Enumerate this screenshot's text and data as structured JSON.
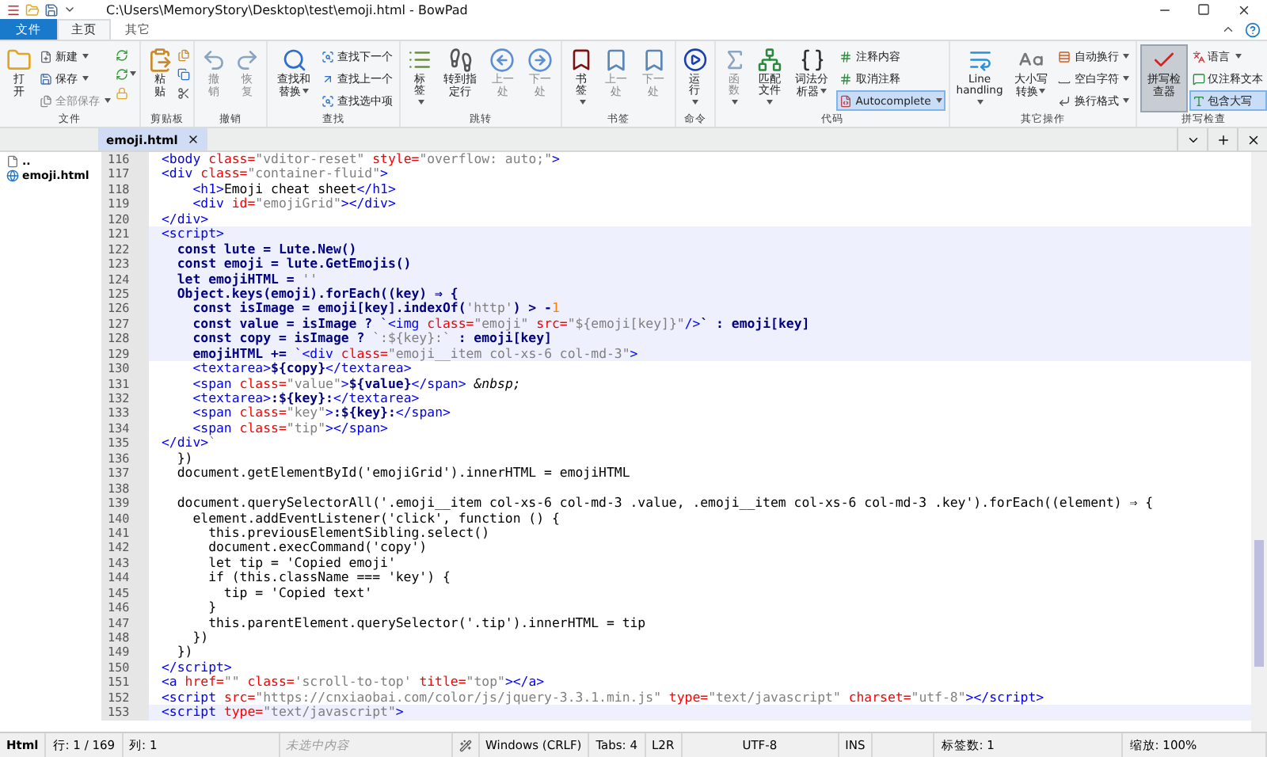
{
  "window": {
    "title": "C:\\Users\\MemoryStory\\Desktop\\test\\emoji.html - BowPad"
  },
  "file_menu": {
    "label": "文件"
  },
  "ribbon_tabs": [
    {
      "label": "主页",
      "selected": true
    },
    {
      "label": "其它",
      "selected": false
    }
  ],
  "ribbon_groups": [
    {
      "label": "文件",
      "large": [
        {
          "label": "打开",
          "dropdown": false,
          "disabled": false,
          "pressed": false
        }
      ],
      "small": [
        {
          "label": "新建",
          "dropdown": true,
          "disabled": false,
          "pressed": false
        },
        {
          "label": "保存",
          "dropdown": true,
          "disabled": false,
          "pressed": false
        },
        {
          "label": "全部保存",
          "dropdown": true,
          "disabled": true,
          "pressed": false
        }
      ],
      "tools": [
        {
          "dropdown": false
        },
        {
          "dropdown": true
        },
        {
          "dropdown": false
        }
      ]
    },
    {
      "label": "剪贴板",
      "large": [
        {
          "label": "粘贴",
          "dropdown": false,
          "disabled": false,
          "pressed": false
        }
      ],
      "tools": [
        {
          "dropdown": false
        },
        {
          "dropdown": false
        },
        {
          "dropdown": false
        }
      ]
    },
    {
      "label": "撤销",
      "large": [
        {
          "label": "撤销",
          "dropdown": false,
          "disabled": true,
          "pressed": false
        },
        {
          "label": "恢复",
          "dropdown": false,
          "disabled": true,
          "pressed": false
        }
      ]
    },
    {
      "label": "查找",
      "large": [
        {
          "label": "查找和替换",
          "dropdown": true,
          "disabled": false,
          "pressed": false
        }
      ],
      "small": [
        {
          "label": "查找下一个",
          "dropdown": false,
          "disabled": false,
          "pressed": false
        },
        {
          "label": "查找上一个",
          "dropdown": false,
          "disabled": false,
          "pressed": false
        },
        {
          "label": "查找选中项",
          "dropdown": false,
          "disabled": false,
          "pressed": false
        }
      ]
    },
    {
      "label": "跳转",
      "large": [
        {
          "label": "标签",
          "dropdown": true,
          "disabled": false,
          "pressed": false
        },
        {
          "label": "转到指定行",
          "dropdown": false,
          "disabled": false,
          "pressed": false
        },
        {
          "label": "上一处",
          "dropdown": false,
          "disabled": true,
          "pressed": false
        },
        {
          "label": "下一处",
          "dropdown": false,
          "disabled": true,
          "pressed": false
        }
      ]
    },
    {
      "label": "书签",
      "large": [
        {
          "label": "书签",
          "dropdown": true,
          "disabled": false,
          "pressed": false
        },
        {
          "label": "上一处",
          "dropdown": false,
          "disabled": true,
          "pressed": false
        },
        {
          "label": "下一处",
          "dropdown": false,
          "disabled": true,
          "pressed": false
        }
      ]
    },
    {
      "label": "命令",
      "large": [
        {
          "label": "运行",
          "dropdown": true,
          "disabled": false,
          "pressed": false
        }
      ]
    },
    {
      "label": "代码",
      "large": [
        {
          "label": "函数",
          "dropdown": true,
          "disabled": true,
          "pressed": false
        },
        {
          "label": "匹配文件",
          "dropdown": true,
          "disabled": false,
          "pressed": false
        },
        {
          "label": "词法分析器",
          "dropdown": true,
          "disabled": false,
          "pressed": false
        }
      ],
      "small": [
        {
          "label": "注释内容",
          "dropdown": false,
          "disabled": false,
          "pressed": false
        },
        {
          "label": "取消注释",
          "dropdown": false,
          "disabled": false,
          "pressed": false
        },
        {
          "label": "Autocomplete",
          "dropdown": true,
          "disabled": false,
          "pressed": true
        }
      ]
    },
    {
      "label": "其它操作",
      "large": [
        {
          "label": "Line handling",
          "dropdown": true,
          "disabled": false,
          "pressed": false
        },
        {
          "label": "大小写转换",
          "dropdown": true,
          "disabled": false,
          "pressed": false
        }
      ],
      "small": [
        {
          "label": "自动换行",
          "dropdown": true,
          "disabled": false,
          "pressed": false
        },
        {
          "label": "空白字符",
          "dropdown": true,
          "disabled": false,
          "pressed": false
        },
        {
          "label": "换行格式",
          "dropdown": true,
          "disabled": false,
          "pressed": false
        }
      ]
    },
    {
      "label": "拼写检查",
      "large": [
        {
          "label": "拼写检查器",
          "dropdown": false,
          "disabled": false,
          "pressed": true
        }
      ],
      "small": [
        {
          "label": "语言",
          "dropdown": true,
          "disabled": false,
          "pressed": false
        },
        {
          "label": "仅注释文本",
          "dropdown": false,
          "disabled": false,
          "pressed": false
        },
        {
          "label": "包含大写",
          "dropdown": false,
          "disabled": false,
          "pressed": true
        }
      ]
    }
  ],
  "file_tree": [
    {
      "label": ".."
    },
    {
      "label": "emoji.html"
    }
  ],
  "document_tabs": [
    {
      "label": "emoji.html",
      "selected": true
    }
  ],
  "code_lines": [
    {
      "number": "116",
      "highlighted": false,
      "tokens": [
        {
          "kind": "tag",
          "text": "<body"
        },
        {
          "kind": "attr",
          "text": " class="
        },
        {
          "kind": "string",
          "text": "\"vditor-reset\""
        },
        {
          "kind": "attr",
          "text": " style="
        },
        {
          "kind": "string",
          "text": "\"overflow: auto;\""
        },
        {
          "kind": "tag",
          "text": ">"
        }
      ]
    },
    {
      "number": "117",
      "highlighted": false,
      "tokens": [
        {
          "kind": "tag",
          "text": "<div"
        },
        {
          "kind": "attr",
          "text": " class="
        },
        {
          "kind": "string",
          "text": "\"container-fluid\""
        },
        {
          "kind": "tag",
          "text": ">"
        }
      ]
    },
    {
      "number": "118",
      "highlighted": false,
      "tokens": [
        {
          "kind": "tag",
          "text": "    <h1>"
        },
        {
          "kind": "plain",
          "text": "Emoji cheat sheet"
        },
        {
          "kind": "tag",
          "text": "</h1>"
        }
      ]
    },
    {
      "number": "119",
      "highlighted": false,
      "tokens": [
        {
          "kind": "tag",
          "text": "    <div"
        },
        {
          "kind": "attr",
          "text": " id="
        },
        {
          "kind": "string",
          "text": "\"emojiGrid\""
        },
        {
          "kind": "tag",
          "text": "></div>"
        }
      ]
    },
    {
      "number": "120",
      "highlighted": false,
      "tokens": [
        {
          "kind": "tag",
          "text": "</div>"
        }
      ]
    },
    {
      "number": "121",
      "highlighted": true,
      "tokens": [
        {
          "kind": "tag",
          "text": "<script>"
        }
      ]
    },
    {
      "number": "122",
      "highlighted": true,
      "tokens": [
        {
          "kind": "js",
          "text": "  const lute = Lute.New()"
        }
      ]
    },
    {
      "number": "123",
      "highlighted": true,
      "tokens": [
        {
          "kind": "js",
          "text": "  const emoji = lute.GetEmojis()"
        }
      ]
    },
    {
      "number": "124",
      "highlighted": true,
      "tokens": [
        {
          "kind": "js",
          "text": "  let emojiHTML = "
        },
        {
          "kind": "string",
          "text": "''"
        }
      ]
    },
    {
      "number": "125",
      "highlighted": true,
      "tokens": [
        {
          "kind": "js",
          "text": "  Object.keys(emoji).forEach((key) ⇒ {"
        }
      ]
    },
    {
      "number": "126",
      "highlighted": true,
      "tokens": [
        {
          "kind": "js",
          "text": "    const isImage = emoji[key].indexOf("
        },
        {
          "kind": "string",
          "text": "'http'"
        },
        {
          "kind": "js",
          "text": ") > -"
        },
        {
          "kind": "number",
          "text": "1"
        }
      ]
    },
    {
      "number": "127",
      "highlighted": true,
      "tokens": [
        {
          "kind": "js",
          "text": "    const value = isImage ? "
        },
        {
          "kind": "tag",
          "text": "`<img"
        },
        {
          "kind": "attr",
          "text": " class="
        },
        {
          "kind": "string",
          "text": "\"emoji\""
        },
        {
          "kind": "attr",
          "text": " src="
        },
        {
          "kind": "string",
          "text": "\"${emoji[key]}\""
        },
        {
          "kind": "tag",
          "text": "/>"
        },
        {
          "kind": "js",
          "text": "` : emoji[key]"
        }
      ]
    },
    {
      "number": "128",
      "highlighted": true,
      "tokens": [
        {
          "kind": "js",
          "text": "    const copy = isImage ? "
        },
        {
          "kind": "string",
          "text": "`:${key}:`"
        },
        {
          "kind": "js",
          "text": " : emoji[key]"
        }
      ]
    },
    {
      "number": "129",
      "highlighted": true,
      "tokens": [
        {
          "kind": "js",
          "text": "    emojiHTML += "
        },
        {
          "kind": "tag",
          "text": "`<div"
        },
        {
          "kind": "attr",
          "text": " class="
        },
        {
          "kind": "string",
          "text": "\"emoji__item col-xs-6 col-md-3\""
        },
        {
          "kind": "tag",
          "text": ">"
        }
      ]
    },
    {
      "number": "130",
      "highlighted": false,
      "tokens": [
        {
          "kind": "tag",
          "text": "    <textarea>"
        },
        {
          "kind": "js",
          "text": "${copy}"
        },
        {
          "kind": "tag",
          "text": "</textarea>"
        }
      ]
    },
    {
      "number": "131",
      "highlighted": false,
      "tokens": [
        {
          "kind": "tag",
          "text": "    <span"
        },
        {
          "kind": "attr",
          "text": " class="
        },
        {
          "kind": "string",
          "text": "\"value\""
        },
        {
          "kind": "tag",
          "text": ">"
        },
        {
          "kind": "js",
          "text": "${value}"
        },
        {
          "kind": "tag",
          "text": "</span>"
        },
        {
          "kind": "entity",
          "text": " &nbsp;"
        }
      ]
    },
    {
      "number": "132",
      "highlighted": false,
      "tokens": [
        {
          "kind": "tag",
          "text": "    <textarea>"
        },
        {
          "kind": "js",
          "text": ":${key}:"
        },
        {
          "kind": "tag",
          "text": "</textarea>"
        }
      ]
    },
    {
      "number": "133",
      "highlighted": false,
      "tokens": [
        {
          "kind": "tag",
          "text": "    <span"
        },
        {
          "kind": "attr",
          "text": " class="
        },
        {
          "kind": "string",
          "text": "\"key\""
        },
        {
          "kind": "tag",
          "text": ">"
        },
        {
          "kind": "js",
          "text": ":${key}:"
        },
        {
          "kind": "tag",
          "text": "</span>"
        }
      ]
    },
    {
      "number": "134",
      "highlighted": false,
      "tokens": [
        {
          "kind": "tag",
          "text": "    <span"
        },
        {
          "kind": "attr",
          "text": " class="
        },
        {
          "kind": "string",
          "text": "\"tip\""
        },
        {
          "kind": "tag",
          "text": "></span>"
        }
      ]
    },
    {
      "number": "135",
      "highlighted": false,
      "tokens": [
        {
          "kind": "tag",
          "text": "</div>"
        },
        {
          "kind": "string",
          "text": "`"
        }
      ]
    },
    {
      "number": "136",
      "highlighted": false,
      "tokens": [
        {
          "kind": "plain",
          "text": "  })"
        }
      ]
    },
    {
      "number": "137",
      "highlighted": false,
      "tokens": [
        {
          "kind": "plain",
          "text": "  document.getElementById('emojiGrid').innerHTML = emojiHTML"
        }
      ]
    },
    {
      "number": "138",
      "highlighted": false
    },
    {
      "number": "139",
      "highlighted": false,
      "tokens": [
        {
          "kind": "plain",
          "text": "  document.querySelectorAll('.emoji__item col-xs-6 col-md-3 .value, .emoji__item col-xs-6 col-md-3 .key').forEach((element) ⇒ {"
        }
      ]
    },
    {
      "number": "140",
      "highlighted": false,
      "tokens": [
        {
          "kind": "plain",
          "text": "    element.addEventListener('click', function () {"
        }
      ]
    },
    {
      "number": "141",
      "highlighted": false,
      "tokens": [
        {
          "kind": "plain",
          "text": "      this.previousElementSibling.select()"
        }
      ]
    },
    {
      "number": "142",
      "highlighted": false,
      "tokens": [
        {
          "kind": "plain",
          "text": "      document.execCommand('copy')"
        }
      ]
    },
    {
      "number": "143",
      "highlighted": false,
      "tokens": [
        {
          "kind": "plain",
          "text": "      let tip = 'Copied emoji'"
        }
      ]
    },
    {
      "number": "144",
      "highlighted": false,
      "tokens": [
        {
          "kind": "plain",
          "text": "      if (this.className === 'key') {"
        }
      ]
    },
    {
      "number": "145",
      "highlighted": false,
      "tokens": [
        {
          "kind": "plain",
          "text": "        tip = 'Copied text'"
        }
      ]
    },
    {
      "number": "146",
      "highlighted": false,
      "tokens": [
        {
          "kind": "plain",
          "text": "      }"
        }
      ]
    },
    {
      "number": "147",
      "highlighted": false,
      "tokens": [
        {
          "kind": "plain",
          "text": "      this.parentElement.querySelector('.tip').innerHTML = tip"
        }
      ]
    },
    {
      "number": "148",
      "highlighted": false,
      "tokens": [
        {
          "kind": "plain",
          "text": "    })"
        }
      ]
    },
    {
      "number": "149",
      "highlighted": false,
      "tokens": [
        {
          "kind": "plain",
          "text": "  })"
        }
      ]
    },
    {
      "number": "150",
      "highlighted": false,
      "tokens": [
        {
          "kind": "tag",
          "text": "</script>"
        }
      ]
    },
    {
      "number": "151",
      "highlighted": false,
      "tokens": [
        {
          "kind": "tag",
          "text": "<a"
        },
        {
          "kind": "attr",
          "text": " href="
        },
        {
          "kind": "string",
          "text": "\"\""
        },
        {
          "kind": "attr",
          "text": " class="
        },
        {
          "kind": "string",
          "text": "'scroll-to-top'"
        },
        {
          "kind": "attr",
          "text": " title="
        },
        {
          "kind": "string",
          "text": "\"top\""
        },
        {
          "kind": "tag",
          "text": "></a>"
        }
      ]
    },
    {
      "number": "152",
      "highlighted": false,
      "tokens": [
        {
          "kind": "tag",
          "text": "<script"
        },
        {
          "kind": "attr",
          "text": " src="
        },
        {
          "kind": "string",
          "text": "\"https://cnxiaobai.com/color/js/jquery-3.3.1.min.js\""
        },
        {
          "kind": "attr",
          "text": " type="
        },
        {
          "kind": "string",
          "text": "\"text/javascript\""
        },
        {
          "kind": "attr",
          "text": " charset="
        },
        {
          "kind": "string",
          "text": "\"utf-8\""
        },
        {
          "kind": "tag",
          "text": "></script>"
        }
      ]
    },
    {
      "number": "153",
      "highlighted": true,
      "tokens": [
        {
          "kind": "tag",
          "text": "<script"
        },
        {
          "kind": "attr",
          "text": " type="
        },
        {
          "kind": "string",
          "text": "\"text/javascript\""
        },
        {
          "kind": "tag",
          "text": ">"
        }
      ]
    }
  ],
  "status_bar": [
    {
      "kind": "text",
      "text": "Html"
    },
    {
      "kind": "text",
      "text": "行: 1 / 169"
    },
    {
      "kind": "text",
      "text": "列: 1"
    },
    {
      "kind": "muted",
      "text": "未选中内容"
    },
    {
      "kind": "icon"
    },
    {
      "kind": "text",
      "text": "Windows (CRLF)"
    },
    {
      "kind": "text",
      "text": "Tabs: 4"
    },
    {
      "kind": "text",
      "text": "L2R"
    },
    {
      "kind": "text",
      "text": "UTF-8"
    },
    {
      "kind": "text",
      "text": "INS"
    },
    {
      "kind": "empty"
    },
    {
      "kind": "text",
      "text": "标签数: 1"
    },
    {
      "kind": "text",
      "text": "缩放: 100%"
    }
  ]
}
